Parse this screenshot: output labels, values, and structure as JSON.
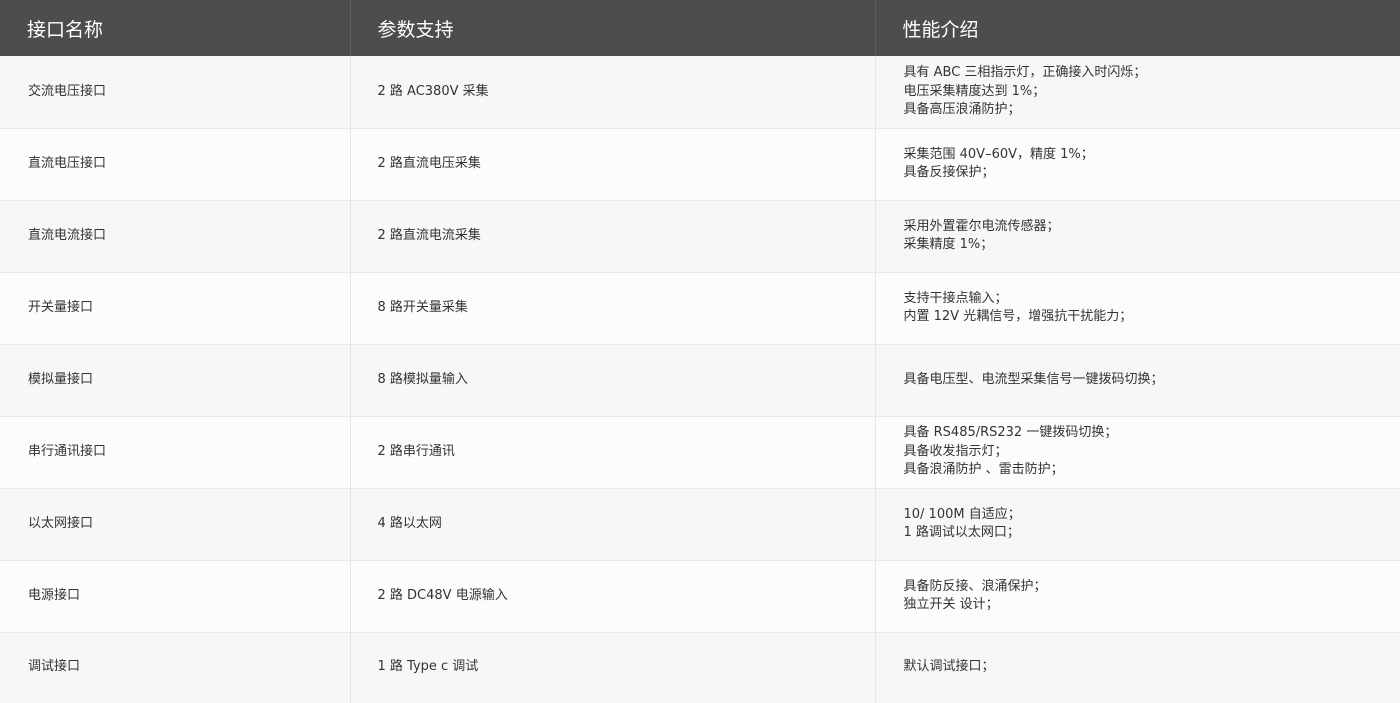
{
  "headers": [
    "接口名称",
    "参数支持",
    "性能介绍"
  ],
  "rows": [
    {
      "name": "交流电压接口",
      "param": "2 路 AC380V 采集",
      "perf": [
        "具有 ABC 三相指示灯，正确接入时闪烁；",
        "电压采集精度达到 1%；",
        "具备高压浪涌防护；"
      ]
    },
    {
      "name": "直流电压接口",
      "param": "2 路直流电压采集",
      "perf": [
        "采集范围 40V–60V，精度 1%；",
        "具备反接保护；"
      ]
    },
    {
      "name": "直流电流接口",
      "param": "2 路直流电流采集",
      "perf": [
        "采用外置霍尔电流传感器；",
        "采集精度 1%；"
      ]
    },
    {
      "name": "开关量接口",
      "param": "8 路开关量采集",
      "perf": [
        "支持干接点输入；",
        "内置 12V 光耦信号，增强抗干扰能力；"
      ]
    },
    {
      "name": "模拟量接口",
      "param": "8 路模拟量输入",
      "perf": [
        "具备电压型、电流型采集信号一键拨码切换；"
      ]
    },
    {
      "name": "串行通讯接口",
      "param": "2 路串行通讯",
      "perf": [
        "具备 RS485/RS232 一键拨码切换；",
        "具备收发指示灯；",
        "具备浪涌防护 、雷击防护；"
      ]
    },
    {
      "name": "以太网接口",
      "param": "4 路以太网",
      "perf": [
        "10/ 100M 自适应；",
        "1 路调试以太网口；"
      ]
    },
    {
      "name": "电源接口",
      "param": "2 路 DC48V 电源输入",
      "perf": [
        "具备防反接、浪涌保护；",
        "独立开关 设计；"
      ]
    },
    {
      "name": "调试接口",
      "param": "1 路 Type c 调试",
      "perf": [
        "默认调试接口；"
      ]
    }
  ]
}
